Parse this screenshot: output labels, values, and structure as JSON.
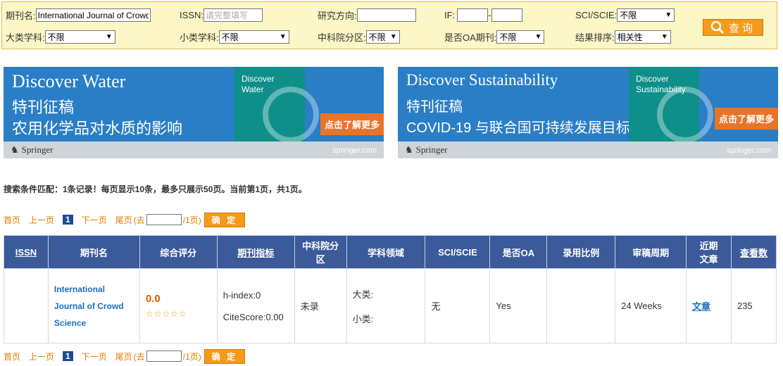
{
  "search": {
    "journal_label": "期刊名:",
    "journal_value": "International Journal of Crowd Science",
    "issn_label": "ISSN:",
    "issn_placeholder": "请完整填写",
    "direction_label": "研究方向:",
    "if_label": "IF:",
    "if_sep": "-",
    "sci_label": "SCI/SCIE:",
    "sci_value": "不限",
    "major_label": "大类学科:",
    "major_value": "不限",
    "minor_label": "小类学科:",
    "minor_value": "不限",
    "cas_label": "中科院分区:",
    "cas_value": "不限",
    "oa_label": "是否OA期刊:",
    "oa_value": "不限",
    "sort_label": "结果排序:",
    "sort_value": "相关性",
    "search_button": "查询"
  },
  "ads": [
    {
      "title": "Discover Water",
      "line1": "特刊征稿",
      "line2": "农用化学品对水质的影响",
      "cover": "Discover\nWater",
      "cta": "点击了解更多",
      "brand": "Springer",
      "url": "springer.com"
    },
    {
      "title": "Discover Sustainability",
      "line1": "特刊征稿",
      "line2": "COVID-19 与联合国可持续发展目标",
      "cover": "Discover\nSustainability",
      "cta": "点击了解更多",
      "brand": "Springer",
      "url": "springer.com"
    }
  ],
  "summary": "搜索条件匹配：1条记录！每页显示10条，最多只展示50页。当前第1页，共1页。",
  "pager": {
    "first": "首页",
    "prev": "上一页",
    "current": "1",
    "next": "下一页",
    "last": "尾页",
    "goto_pre": "(去",
    "goto_post": "/1页)",
    "ok": "确 定"
  },
  "table": {
    "headers": [
      "ISSN",
      "期刊名",
      "综合评分",
      "期刊指标",
      "中科院分区",
      "学科领域",
      "SCI/SCIE",
      "是否OA",
      "录用比例",
      "审稿周期",
      "近期文章",
      "查看数"
    ],
    "row": {
      "issn": "",
      "name": "International Journal of Crowd Science",
      "score": "0.0",
      "stars": "☆☆☆☆☆",
      "hindex": "h-index:0",
      "citescore": "CiteScore:0.00",
      "cas": "未录",
      "major": "大类:",
      "minor": "小类:",
      "sci": "无",
      "oa": "Yes",
      "ratio": "",
      "cycle": "24 Weeks",
      "articles": "文章",
      "views": "235"
    }
  },
  "colors": {
    "accent": "#f59a1b",
    "header": "#3a5a9a",
    "link": "#1a6fc2"
  }
}
